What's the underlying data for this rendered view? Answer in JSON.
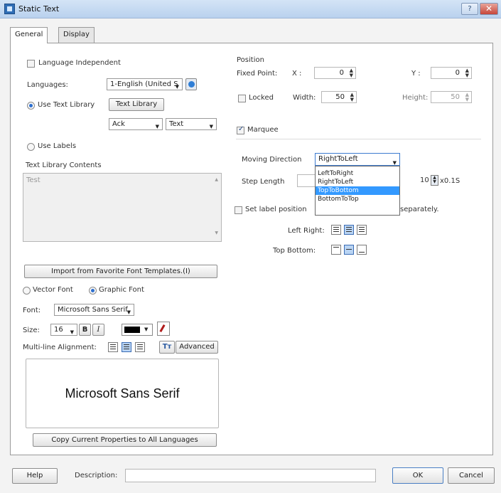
{
  "window": {
    "title": "Static Text",
    "help_label": "?",
    "close_label": "✕"
  },
  "tabs": [
    {
      "label": "General"
    },
    {
      "label": "Display"
    }
  ],
  "general": {
    "language_independent_label": "Language Independent",
    "languages_label": "Languages:",
    "languages_value": "1-English (United S",
    "use_text_library_label": "Use Text Library",
    "text_library_button": "Text Library",
    "library_combo_1": "Ack",
    "library_combo_2": "Text",
    "use_labels_label": "Use Labels",
    "text_library_contents_label": "Text Library Contents",
    "text_library_contents_value": "Test",
    "import_button": "Import from Favorite Font Templates.(I)",
    "vector_font_label": "Vector Font",
    "graphic_font_label": "Graphic Font",
    "font_label": "Font:",
    "font_value": "Microsoft Sans Serif",
    "size_label": "Size:",
    "size_value": "16",
    "bold_label": "B",
    "italic_label": "I",
    "multiline_alignment_label": "Multi-line Alignment:",
    "tt_label": "Tт",
    "advanced_button": "Advanced",
    "preview_text": "Microsoft Sans Serif",
    "copy_button": "Copy Current Properties to All Languages"
  },
  "position": {
    "section_label": "Position",
    "fixed_point_label": "Fixed Point:",
    "x_label": "X :",
    "x_value": "0",
    "y_label": "Y :",
    "y_value": "0",
    "locked_label": "Locked",
    "width_label": "Width:",
    "width_value": "50",
    "height_label": "Height:",
    "height_value": "50"
  },
  "marquee": {
    "checkbox_label": "Marquee",
    "moving_direction_label": "Moving Direction",
    "moving_direction_value": "RightToLeft",
    "direction_options": [
      "LeftToRight",
      "RightToLeft",
      "TopToBottom",
      "BottomToTop"
    ],
    "highlighted_option": "TopToBottom",
    "step_length_label": "Step Length",
    "interval_value": "10",
    "interval_unit": "x0.1S",
    "set_label_position_label": "Set label position",
    "separately_label": "separately.",
    "left_right_label": "Left Right:",
    "top_bottom_label": "Top Bottom:"
  },
  "footer": {
    "help_button": "Help",
    "description_label": "Description:",
    "description_value": "",
    "ok_button": "OK",
    "cancel_button": "Cancel"
  }
}
